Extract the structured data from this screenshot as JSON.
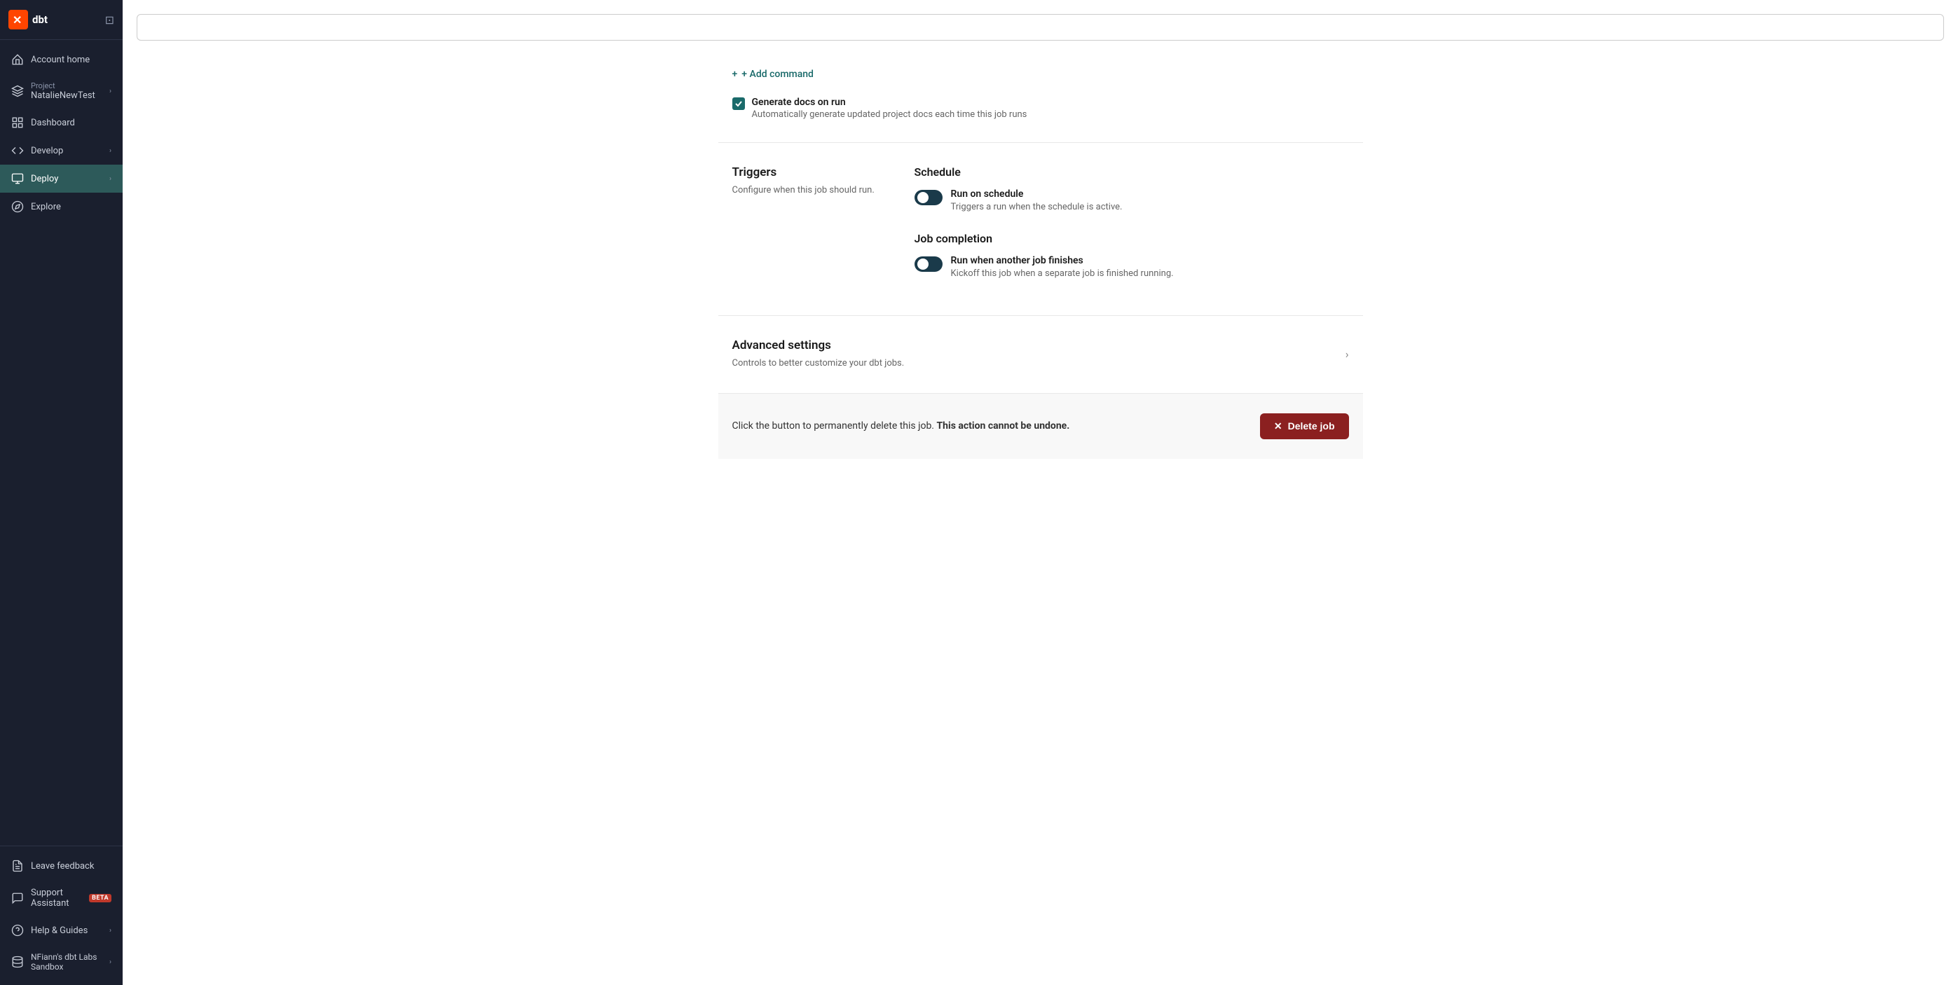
{
  "sidebar": {
    "logo_alt": "dbt logo",
    "toggle_icon": "❮❯",
    "items": [
      {
        "id": "account-home",
        "label": "Account home",
        "icon": "home",
        "active": false,
        "has_chevron": false
      },
      {
        "id": "project",
        "label": "NatalieNewTest",
        "sublabel": "Project",
        "icon": "layers",
        "active": false,
        "has_chevron": true
      },
      {
        "id": "dashboard",
        "label": "Dashboard",
        "icon": "grid",
        "active": false,
        "has_chevron": false
      },
      {
        "id": "develop",
        "label": "Develop",
        "icon": "code",
        "active": false,
        "has_chevron": true
      },
      {
        "id": "deploy",
        "label": "Deploy",
        "icon": "deploy",
        "active": true,
        "has_chevron": true
      },
      {
        "id": "explore",
        "label": "Explore",
        "icon": "compass",
        "active": false,
        "has_chevron": false
      }
    ],
    "bottom_items": [
      {
        "id": "leave-feedback",
        "label": "Leave feedback",
        "icon": "file-text",
        "has_chevron": false
      },
      {
        "id": "support-assistant",
        "label": "Support Assistant",
        "icon": "message",
        "has_chevron": false,
        "badge": "BETA"
      },
      {
        "id": "help-guides",
        "label": "Help & Guides",
        "icon": "help-circle",
        "has_chevron": true
      },
      {
        "id": "nfiann-sandbox",
        "label": "NFiann's dbt Labs Sandbox",
        "icon": "database",
        "has_chevron": true
      }
    ]
  },
  "top_input": {
    "value": "",
    "placeholder": ""
  },
  "add_command": {
    "label": "+ Add command"
  },
  "generate_docs": {
    "label": "Generate docs on run",
    "description": "Automatically generate updated project docs each time this job runs"
  },
  "triggers_section": {
    "title": "Triggers",
    "description": "Configure when this job should run.",
    "schedule": {
      "title": "Schedule",
      "toggle_label": "Run on schedule",
      "toggle_description": "Triggers a run when the schedule is active."
    },
    "job_completion": {
      "title": "Job completion",
      "toggle_label": "Run when another job finishes",
      "toggle_description": "Kickoff this job when a separate job is finished running."
    }
  },
  "advanced_settings": {
    "title": "Advanced settings",
    "description": "Controls to better customize your dbt jobs."
  },
  "delete_section": {
    "text": "Click the button to permanently delete this job.",
    "bold_text": "This action cannot be undone.",
    "button_label": "Delete job"
  }
}
